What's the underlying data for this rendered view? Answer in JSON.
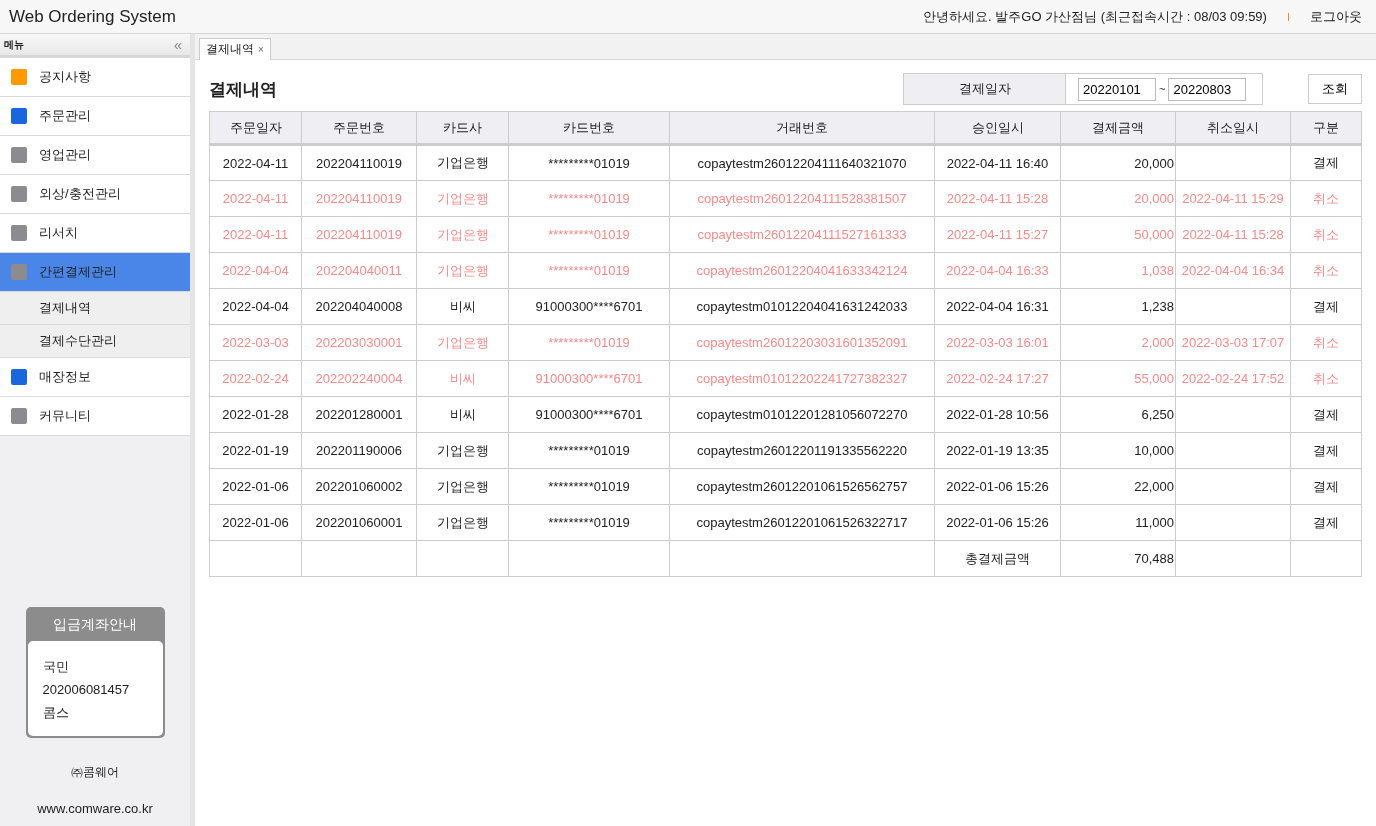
{
  "header": {
    "title": "Web Ordering System",
    "greeting": "안녕하세요. 발주GO 가산점님 (최근접속시간 : 08/03 09:59)",
    "separator": "I",
    "logout": "로그아웃"
  },
  "sidebar": {
    "title": "메뉴",
    "collapse": "«",
    "items": [
      {
        "label": "공지사항",
        "color": "#ff9900",
        "selected": false
      },
      {
        "label": "주문관리",
        "color": "#1a66dd",
        "selected": false
      },
      {
        "label": "영업관리",
        "color": "#8c8c90",
        "selected": false
      },
      {
        "label": "외상/충전관리",
        "color": "#8c8c90",
        "selected": false
      },
      {
        "label": "리서치",
        "color": "#8c8c90",
        "selected": false
      },
      {
        "label": "간편결제관리",
        "color": "#8c8c90",
        "selected": true,
        "children": [
          {
            "label": "결제내역"
          },
          {
            "label": "결제수단관리"
          }
        ]
      },
      {
        "label": "매장정보",
        "color": "#1a66dd",
        "selected": false
      },
      {
        "label": "커뮤니티",
        "color": "#8c8c90",
        "selected": false
      }
    ],
    "account_card": {
      "title": "입금계좌안내",
      "lines": [
        "국민",
        "202006081457",
        "콤스"
      ]
    },
    "company": "㈜콤웨어",
    "website": "www.comware.co.kr"
  },
  "tabs": [
    {
      "label": "결제내역",
      "close": "×",
      "selected": true
    }
  ],
  "page_title": "결제내역",
  "filter": {
    "label": "결제일자",
    "from": "20220101",
    "range_sep": "~",
    "to": "20220803",
    "search_button": "조회"
  },
  "table": {
    "columns": [
      "주문일자",
      "주문번호",
      "카드사",
      "카드번호",
      "거래번호",
      "승인일시",
      "결제금액",
      "취소일시",
      "구분"
    ],
    "rows": [
      {
        "cancelled": false,
        "cells": [
          "2022-04-11",
          "202204110019",
          "기업은행",
          "*********01019",
          "copaytestm26012204111640321070",
          "2022-04-11 16:40",
          "20,000",
          "",
          "결제"
        ]
      },
      {
        "cancelled": true,
        "cells": [
          "2022-04-11",
          "202204110019",
          "기업은행",
          "*********01019",
          "copaytestm26012204111528381507",
          "2022-04-11 15:28",
          "20,000",
          "2022-04-11 15:29",
          "취소"
        ]
      },
      {
        "cancelled": true,
        "cells": [
          "2022-04-11",
          "202204110019",
          "기업은행",
          "*********01019",
          "copaytestm26012204111527161333",
          "2022-04-11 15:27",
          "50,000",
          "2022-04-11 15:28",
          "취소"
        ]
      },
      {
        "cancelled": true,
        "cells": [
          "2022-04-04",
          "202204040011",
          "기업은행",
          "*********01019",
          "copaytestm26012204041633342124",
          "2022-04-04 16:33",
          "1,038",
          "2022-04-04 16:34",
          "취소"
        ]
      },
      {
        "cancelled": false,
        "cells": [
          "2022-04-04",
          "202204040008",
          "비씨",
          "91000300****6701",
          "copaytestm01012204041631242033",
          "2022-04-04 16:31",
          "1,238",
          "",
          "결제"
        ]
      },
      {
        "cancelled": true,
        "cells": [
          "2022-03-03",
          "202203030001",
          "기업은행",
          "*********01019",
          "copaytestm26012203031601352091",
          "2022-03-03 16:01",
          "2,000",
          "2022-03-03 17:07",
          "취소"
        ]
      },
      {
        "cancelled": true,
        "cells": [
          "2022-02-24",
          "202202240004",
          "비씨",
          "91000300****6701",
          "copaytestm01012202241727382327",
          "2022-02-24 17:27",
          "55,000",
          "2022-02-24 17:52",
          "취소"
        ]
      },
      {
        "cancelled": false,
        "cells": [
          "2022-01-28",
          "202201280001",
          "비씨",
          "91000300****6701",
          "copaytestm01012201281056072270",
          "2022-01-28 10:56",
          "6,250",
          "",
          "결제"
        ]
      },
      {
        "cancelled": false,
        "cells": [
          "2022-01-19",
          "202201190006",
          "기업은행",
          "*********01019",
          "copaytestm26012201191335562220",
          "2022-01-19 13:35",
          "10,000",
          "",
          "결제"
        ]
      },
      {
        "cancelled": false,
        "cells": [
          "2022-01-06",
          "202201060002",
          "기업은행",
          "*********01019",
          "copaytestm26012201061526562757",
          "2022-01-06 15:26",
          "22,000",
          "",
          "결제"
        ]
      },
      {
        "cancelled": false,
        "cells": [
          "2022-01-06",
          "202201060001",
          "기업은행",
          "*********01019",
          "copaytestm26012201061526322717",
          "2022-01-06 15:26",
          "11,000",
          "",
          "결제"
        ]
      }
    ],
    "total": {
      "label": "총결제금액",
      "value": "70,488"
    }
  }
}
